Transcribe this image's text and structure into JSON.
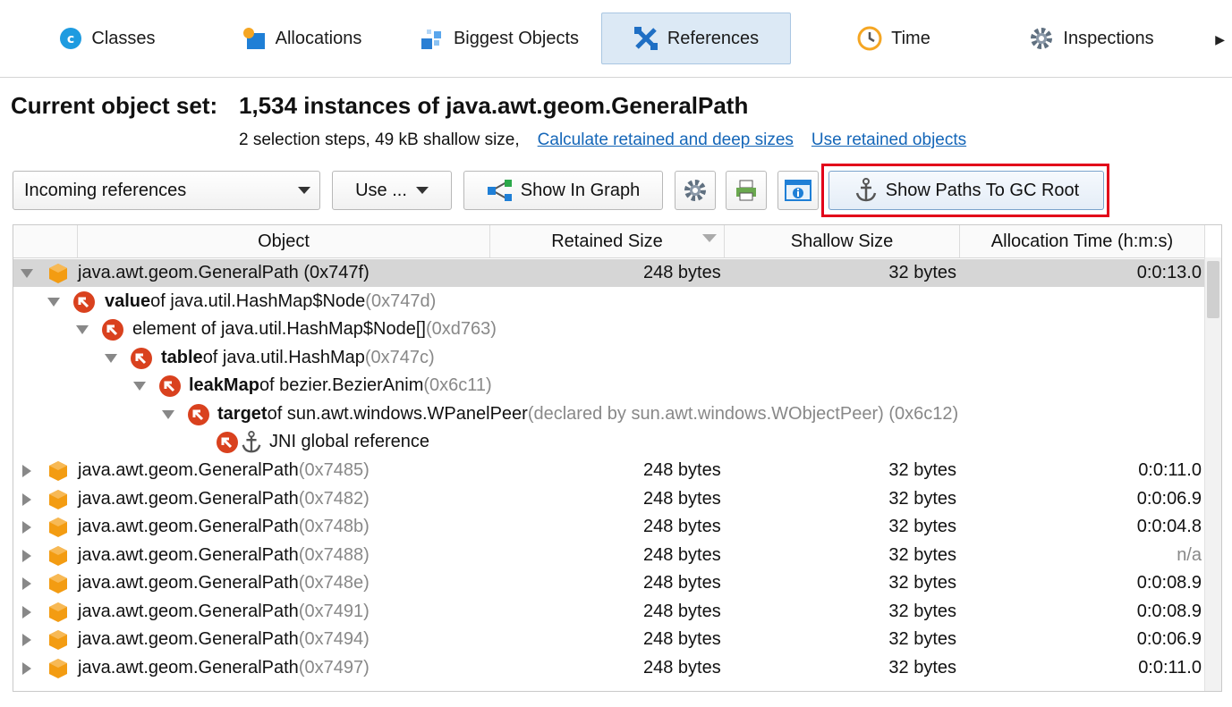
{
  "tabs": [
    {
      "label": "Classes",
      "icon": "classes-icon"
    },
    {
      "label": "Allocations",
      "icon": "allocations-icon"
    },
    {
      "label": "Biggest Objects",
      "icon": "biggest-objects-icon"
    },
    {
      "label": "References",
      "icon": "references-icon",
      "active": true
    },
    {
      "label": "Time",
      "icon": "time-icon"
    },
    {
      "label": "Inspections",
      "icon": "gear-icon"
    }
  ],
  "header": {
    "title_label": "Current object set:",
    "title_value": "1,534 instances of java.awt.geom.GeneralPath",
    "summary": "2 selection steps, 49 kB shallow size,",
    "link_calc": "Calculate retained and deep sizes",
    "link_use": "Use retained objects"
  },
  "toolbar": {
    "dropdown_value": "Incoming references",
    "use_label": "Use ...",
    "graph_label": "Show In Graph",
    "gc_label": "Show Paths To GC Root"
  },
  "table": {
    "columns": [
      "Object",
      "Retained Size",
      "Shallow Size",
      "Allocation Time (h:m:s)"
    ],
    "selected": {
      "name": "java.awt.geom.GeneralPath",
      "id": "(0x747f)",
      "retained": "248 bytes",
      "shallow": "32 bytes",
      "time": "0:0:13.0"
    },
    "path": [
      {
        "bold": "value",
        "text": " of java.util.HashMap$Node",
        "id": " (0x747d)"
      },
      {
        "bold": "",
        "text": "element of java.util.HashMap$Node[]",
        "id": " (0xd763)"
      },
      {
        "bold": "table",
        "text": " of java.util.HashMap",
        "id": " (0x747c)"
      },
      {
        "bold": "leakMap",
        "text": " of bezier.BezierAnim",
        "id": " (0x6c11)"
      },
      {
        "bold": "target",
        "text": " of sun.awt.windows.WPanelPeer",
        "id": " (declared by sun.awt.windows.WObjectPeer) (0x6c12)"
      },
      {
        "bold": "",
        "text": "JNI global reference",
        "id": ""
      }
    ],
    "rows": [
      {
        "name": "java.awt.geom.GeneralPath",
        "id": " (0x7485)",
        "retained": "248 bytes",
        "shallow": "32 bytes",
        "time": "0:0:11.0"
      },
      {
        "name": "java.awt.geom.GeneralPath",
        "id": " (0x7482)",
        "retained": "248 bytes",
        "shallow": "32 bytes",
        "time": "0:0:06.9"
      },
      {
        "name": "java.awt.geom.GeneralPath",
        "id": " (0x748b)",
        "retained": "248 bytes",
        "shallow": "32 bytes",
        "time": "0:0:04.8"
      },
      {
        "name": "java.awt.geom.GeneralPath",
        "id": " (0x7488)",
        "retained": "248 bytes",
        "shallow": "32 bytes",
        "time": "n/a"
      },
      {
        "name": "java.awt.geom.GeneralPath",
        "id": " (0x748e)",
        "retained": "248 bytes",
        "shallow": "32 bytes",
        "time": "0:0:08.9"
      },
      {
        "name": "java.awt.geom.GeneralPath",
        "id": " (0x7491)",
        "retained": "248 bytes",
        "shallow": "32 bytes",
        "time": "0:0:08.9"
      },
      {
        "name": "java.awt.geom.GeneralPath",
        "id": " (0x7494)",
        "retained": "248 bytes",
        "shallow": "32 bytes",
        "time": "0:0:06.9"
      },
      {
        "name": "java.awt.geom.GeneralPath",
        "id": " (0x7497)",
        "retained": "248 bytes",
        "shallow": "32 bytes",
        "time": "0:0:11.0"
      }
    ]
  },
  "colors": {
    "accent": "#1466b8",
    "highlight": "#e2001a",
    "cube": "#f39c12",
    "ref": "#d9411e"
  }
}
